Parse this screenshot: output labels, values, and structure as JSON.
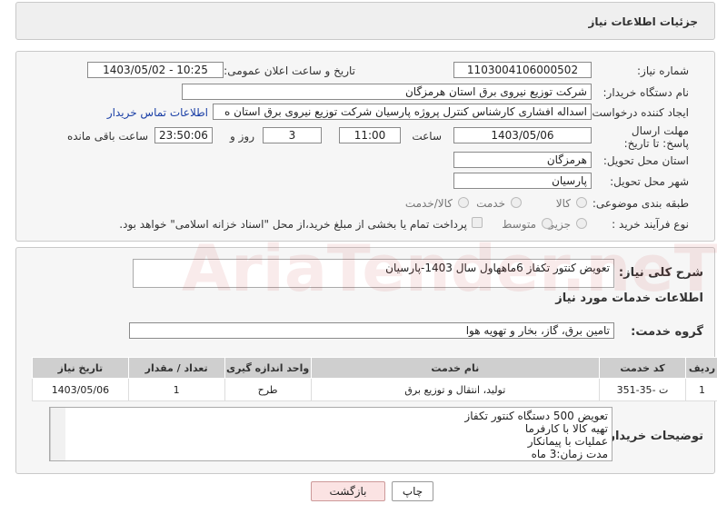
{
  "header": {
    "title": "جزئیات اطلاعات نیاز"
  },
  "fields": {
    "need_number_label": "شماره نیاز:",
    "need_number": "1103004106000502",
    "announce_label": "تاریخ و ساعت اعلان عمومی:",
    "announce_value": "1403/05/02 - 10:25",
    "buyer_label": "نام دستگاه خریدار:",
    "buyer_value": "شرکت توزیع نیروی برق استان هرمزگان",
    "creator_label": "ایجاد کننده درخواست:",
    "creator_value": "اسداله افشاری کارشناس کنترل پروژه پارسیان شرکت توزیع نیروی برق استان ه",
    "contact_link": "اطلاعات تماس خریدار",
    "deadline_label": "مهلت ارسال پاسخ: تا تاریخ:",
    "deadline_date": "1403/05/06",
    "time_label": "ساعت",
    "deadline_time": "11:00",
    "days_value": "3",
    "days_label": "روز و",
    "remaining_time": "23:50:06",
    "remaining_label": "ساعت باقی مانده",
    "province_label": "استان محل تحویل:",
    "province_value": "هرمزگان",
    "city_label": "شهر محل تحویل:",
    "city_value": "پارسیان",
    "category_label": "طبقه بندی موضوعی:",
    "category_options": [
      "کالا",
      "خدمت",
      "کالا/خدمت"
    ],
    "process_label": "نوع فرآیند خرید :",
    "process_options": [
      "جزیی",
      "متوسط"
    ],
    "payment_note": "پرداخت تمام یا بخشی از مبلغ خرید،از محل \"اسناد خزانه اسلامی\" خواهد بود."
  },
  "description": {
    "summary_label": "شرح کلی نیاز:",
    "summary_value": "تعویض کنتور تکفاز 6ماههاول سال 1403-پارسیان",
    "services_title": "اطلاعات خدمات مورد نیاز",
    "group_label": "گروه خدمت:",
    "group_value": "تامین برق، گاز، بخار و تهویه هوا",
    "table": {
      "headers": [
        "ردیف",
        "کد خدمت",
        "نام خدمت",
        "واحد اندازه گیری",
        "تعداد / مقدار",
        "تاریخ نیاز"
      ],
      "rows": [
        [
          "1",
          "ت -35-351",
          "تولید، انتقال و توزیع برق",
          "طرح",
          "1",
          "1403/05/06"
        ]
      ]
    },
    "buyer_notes_label": "توضیحات خریدار:",
    "buyer_notes": [
      "تعویض 500 دستگاه کنتور تکفاز",
      "تهیه کالا با کارفرما",
      "عملیات با پیمانکار",
      "مدت زمان:3 ماه"
    ]
  },
  "buttons": {
    "print": "چاپ",
    "back": "بازگشت"
  },
  "watermark": "AriaTender.neT"
}
